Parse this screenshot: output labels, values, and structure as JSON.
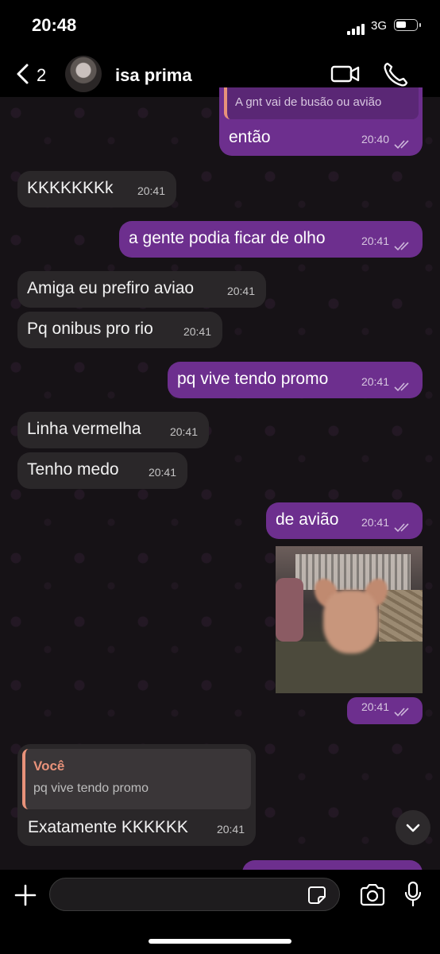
{
  "status_bar": {
    "time": "20:48",
    "network": "3G"
  },
  "header": {
    "back_count": "2",
    "contact_name": "isa prima"
  },
  "messages": [
    {
      "quoted_text": "A gnt vai de busão ou avião",
      "text": "então",
      "time": "20:40"
    },
    {
      "text": "KKKKKKKk",
      "time": "20:41"
    },
    {
      "text": "a gente podia ficar de olho",
      "time": "20:41"
    },
    {
      "text": "Amiga eu prefiro aviao",
      "time": "20:41"
    },
    {
      "text": "Pq onibus pro rio",
      "time": "20:41"
    },
    {
      "text": "pq vive tendo promo",
      "time": "20:41"
    },
    {
      "text": "Linha vermelha",
      "time": "20:41"
    },
    {
      "text": "Tenho medo",
      "time": "20:41"
    },
    {
      "text": "de avião",
      "time": "20:41"
    },
    {
      "time": "20:41"
    },
    {
      "quoted_author": "Você",
      "quoted_text": "pq vive tendo promo",
      "text": "Exatamente KKKKKK",
      "time": "20:41"
    }
  ],
  "colors": {
    "outgoing": "#6d2f8e",
    "incoming": "#2a2729",
    "quote_author": "#e8927a"
  },
  "icons": [
    "back-chevron-icon",
    "video-icon",
    "phone-icon",
    "double-check-icon",
    "chevron-down-icon",
    "plus-icon",
    "sticker-icon",
    "camera-icon",
    "mic-icon"
  ]
}
